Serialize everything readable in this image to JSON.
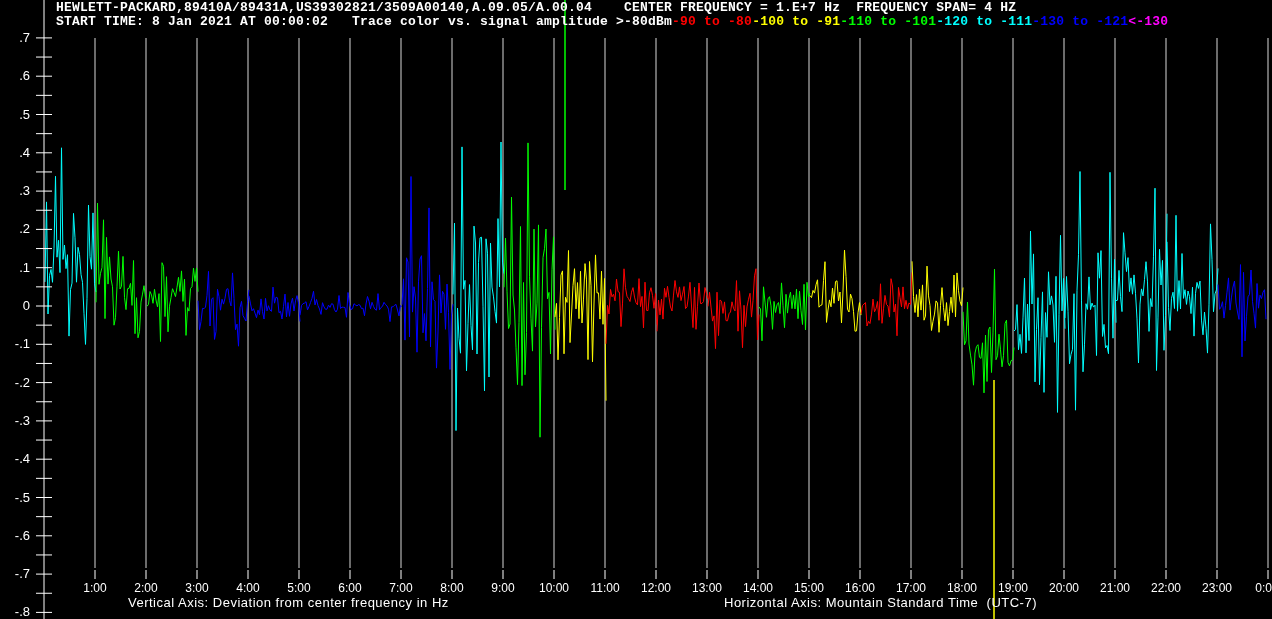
{
  "header": {
    "instrument": "HEWLETT-PACKARD,89410A/89431A,US39302821/3509A00140,A.09.05/A.00.04",
    "center_frequency": "CENTER FREQUENCY = 1.E+7 Hz",
    "frequency_span": "FREQUENCY SPAN= 4 HZ",
    "start_time": "START TIME: 8 Jan 2021 AT 00:00:02",
    "legend_title": "Trace color vs. signal amplitude >-80dBm"
  },
  "legend": [
    {
      "text": "-90 to -80",
      "color": "#ff0000"
    },
    {
      "text": "-100 to -91",
      "color": "#ffff00"
    },
    {
      "text": "-110 to -101",
      "color": "#00ff00"
    },
    {
      "text": "-120 to -111",
      "color": "#00ffff"
    },
    {
      "text": "-130 to -121",
      "color": "#0000ff"
    },
    {
      "text": "<-130",
      "color": "#ff00ff"
    }
  ],
  "plot": {
    "y_ticks": [
      ".7",
      ".6",
      ".5",
      ".4",
      ".3",
      ".2",
      ".1",
      "0",
      "-.1",
      "-.2",
      "-.3",
      "-.4",
      "-.5",
      "-.6",
      "-.7",
      "-.8"
    ],
    "x_ticks": [
      "1:00",
      "2:00",
      "3:00",
      "4:00",
      "5:00",
      "6:00",
      "7:00",
      "8:00",
      "9:00",
      "10:00",
      "11:00",
      "12:00",
      "13:00",
      "14:00",
      "15:00",
      "16:00",
      "17:00",
      "18:00",
      "19:00",
      "20:00",
      "21:00",
      "22:00",
      "23:00",
      "0:0"
    ],
    "vertical_axis_label": "Vertical Axis: Deviation from center frequency in Hz",
    "horizontal_axis_label": "Horizontal Axis: Mountain Standard Time  (UTC-7)"
  }
}
